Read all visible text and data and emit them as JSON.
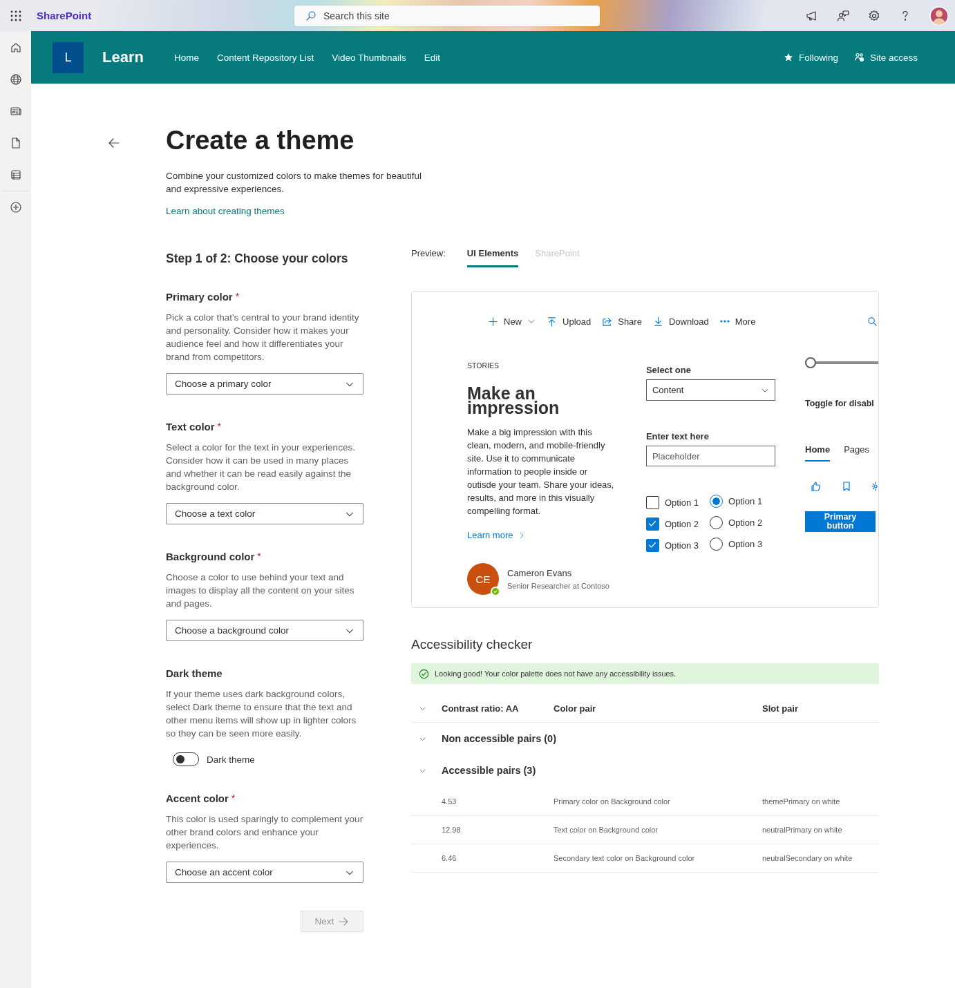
{
  "suite_bar": {
    "app_name": "SharePoint",
    "search": {
      "placeholder": "Search this site"
    }
  },
  "site_header": {
    "logo_letter": "L",
    "title": "Learn",
    "nav": [
      "Home",
      "Content Repository List",
      "Video Thumbnails",
      "Edit"
    ],
    "actions": [
      {
        "kind": "follow",
        "label": "Following"
      },
      {
        "kind": "access",
        "label": "Site access"
      }
    ]
  },
  "page": {
    "title": "Create a theme",
    "intro": "Combine your customized colors to make themes for beautiful and expressive experiences.",
    "link": "Learn about creating themes"
  },
  "step": {
    "title": "Step 1 of 2: Choose your colors",
    "sections": [
      {
        "kind": "picker",
        "label": "Primary color",
        "required_mark": "*",
        "description": "Pick a color that's central to your brand identity and personality. Consider how it makes your audience feel and how it differentiates your brand from competitors.",
        "dropdown": "Choose a primary color"
      },
      {
        "kind": "picker",
        "label": "Text color",
        "required_mark": "*",
        "description": "Select a color for the text in your experiences. Consider how it can be used in many places and whether it can be read easily against the background color.",
        "dropdown": "Choose a text color"
      },
      {
        "kind": "picker",
        "label": "Background color",
        "required_mark": "*",
        "description": "Choose a color to use behind your text and images to display all the content on your sites and pages.",
        "dropdown": "Choose a background color"
      },
      {
        "kind": "toggle",
        "label": "Dark theme",
        "description": "If your theme uses dark background colors, select Dark theme to ensure that the text and other menu items will show up in lighter colors so they can be seen more easily.",
        "toggle": {
          "label": "Dark theme",
          "on": false
        }
      },
      {
        "kind": "picker",
        "label": "Accent color",
        "required_mark": "*",
        "description": "This color is used sparingly to complement your other brand colors and enhance your experiences.",
        "dropdown": "Choose an accent color"
      }
    ],
    "next": {
      "label": "Next",
      "disabled": true
    }
  },
  "preview": {
    "label": "Preview:",
    "tabs": [
      {
        "label": "UI Elements",
        "selected": true
      },
      {
        "label": "SharePoint",
        "selected": false
      }
    ],
    "commands": [
      {
        "kind": "new",
        "label": "New"
      },
      {
        "kind": "upload",
        "label": "Upload"
      },
      {
        "kind": "share",
        "label": "Share"
      },
      {
        "kind": "download",
        "label": "Download"
      },
      {
        "kind": "more",
        "label": "More"
      }
    ],
    "story": {
      "eyebrow": "STORIES",
      "heading": "Make an impression",
      "body": "Make a big impression with this clean, modern, and mobile-friendly site. Use it to communicate information to people inside or outisde your team. Share your ideas, results, and more in this visually compelling format.",
      "link": "Learn more",
      "person": {
        "initials": "CE",
        "name": "Cameron Evans",
        "role": "Senior Researcher at Contoso",
        "online": true
      }
    },
    "dropdown": {
      "label": "Select one",
      "value": "Content"
    },
    "text_field": {
      "label": "Enter text here",
      "placeholder": "Placeholder"
    },
    "checkboxes": [
      {
        "label": "Option 1",
        "checked": false
      },
      {
        "label": "Option 2",
        "checked": true
      },
      {
        "label": "Option 3",
        "checked": true
      }
    ],
    "radios": [
      {
        "label": "Option 1",
        "selected": true
      },
      {
        "label": "Option 2",
        "selected": false
      },
      {
        "label": "Option 3",
        "selected": false
      }
    ],
    "slider": {
      "level": 0
    },
    "toggle_label": "Toggle for disabl",
    "pivots": [
      {
        "label": "Home",
        "selected": true
      },
      {
        "label": "Pages",
        "selected": false
      }
    ],
    "primary_button": "Primary button"
  },
  "accessibility": {
    "title": "Accessibility checker",
    "banner": "Looking good! Your color palette does not have any accessibility issues.",
    "columns": [
      "Contrast ratio: AA",
      "Color pair",
      "Slot pair"
    ],
    "groups": [
      {
        "label": "Non accessible pairs (0)"
      },
      {
        "label": "Accessible pairs (3)",
        "rows": [
          [
            "4.53",
            "Primary color on Background color",
            "themePrimary on white"
          ],
          [
            "12.98",
            "Text color on Background color",
            "neutralPrimary on white"
          ],
          [
            "6.46",
            "Secondary text color on Background color",
            "neutralSecondary on white"
          ]
        ]
      }
    ]
  }
}
